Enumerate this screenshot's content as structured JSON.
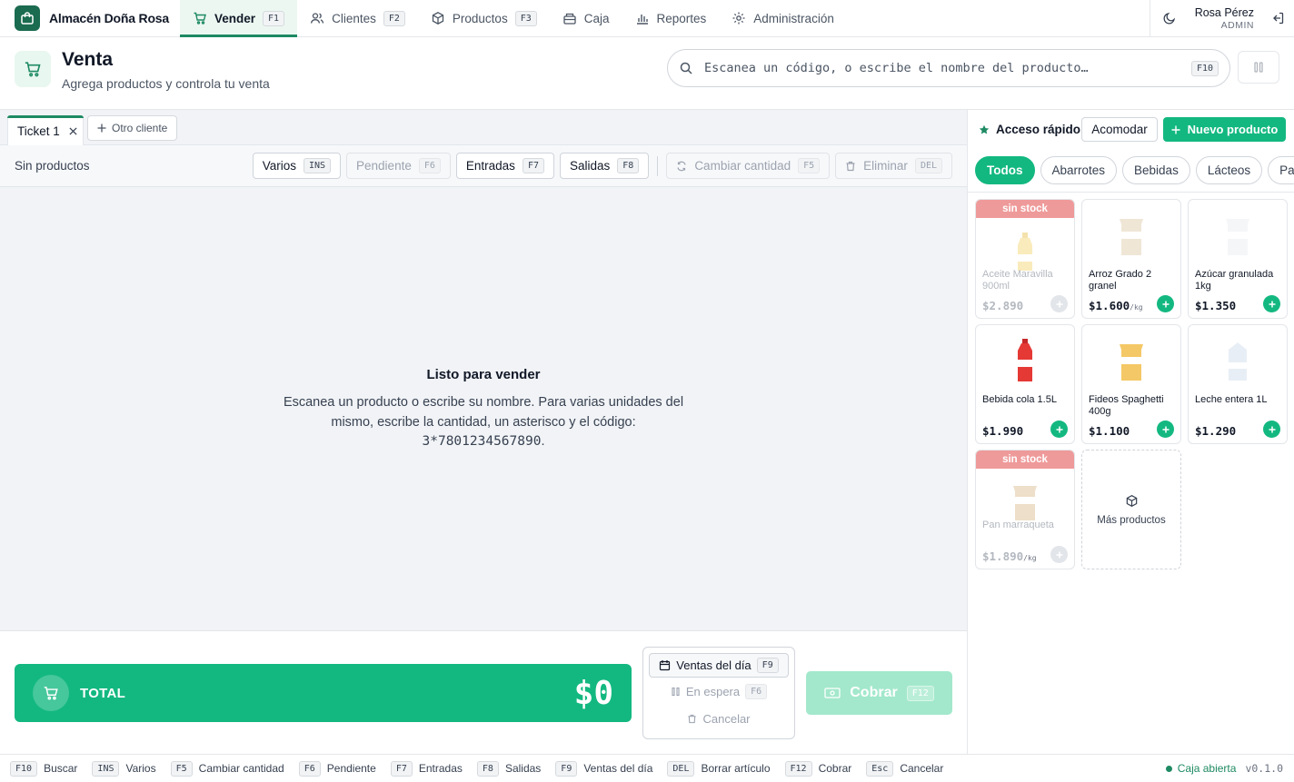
{
  "brand": {
    "name": "Almacén Doña Rosa",
    "icon": "bag-icon"
  },
  "nav": [
    {
      "label": "Vender",
      "key": "F1",
      "icon": "cart-icon",
      "active": true
    },
    {
      "label": "Clientes",
      "key": "F2",
      "icon": "users-icon"
    },
    {
      "label": "Productos",
      "key": "F3",
      "icon": "box-icon"
    },
    {
      "label": "Caja",
      "icon": "register-icon"
    },
    {
      "label": "Reportes",
      "icon": "chart-icon"
    },
    {
      "label": "Administración",
      "icon": "gear-icon"
    }
  ],
  "user": {
    "name": "Rosa Pérez",
    "role": "ADMIN"
  },
  "header": {
    "title": "Venta",
    "subtitle": "Agrega productos y controla tu venta",
    "search_placeholder": "Escanea un código, o escribe el nombre del producto…",
    "search_key": "F10"
  },
  "tabs": {
    "ticket": "Ticket 1",
    "new": "Otro cliente"
  },
  "toolbar": {
    "status": "Sin productos",
    "buttons": [
      {
        "label": "Varios",
        "key": "INS",
        "enabled": true
      },
      {
        "label": "Pendiente",
        "key": "F6",
        "enabled": false
      },
      {
        "label": "Entradas",
        "key": "F7",
        "enabled": true
      },
      {
        "label": "Salidas",
        "key": "F8",
        "enabled": true
      }
    ],
    "cambiar": {
      "label": "Cambiar cantidad",
      "key": "F5"
    },
    "eliminar": {
      "label": "Eliminar",
      "key": "DEL"
    }
  },
  "empty": {
    "title": "Listo para vender",
    "text": "Escanea un producto o escribe su nombre. Para varias unidades del mismo, escribe la cantidad, un asterisco y el código:",
    "code": "3*7801234567890",
    "period": "."
  },
  "total": {
    "label": "TOTAL",
    "amount": "$0"
  },
  "actions": {
    "ventas": {
      "label": "Ventas del día",
      "key": "F9"
    },
    "espera": {
      "label": "En espera",
      "key": "F6"
    },
    "cancelar": "Cancelar"
  },
  "cobrar": {
    "label": "Cobrar",
    "key": "F12"
  },
  "quick": {
    "title": "Acceso rápido",
    "acomodar": "Acomodar",
    "nuevo": "Nuevo producto",
    "categories": [
      "Todos",
      "Abarrotes",
      "Bebidas",
      "Lácteos",
      "Pan"
    ],
    "products": [
      {
        "name": "Aceite Maravilla 900ml",
        "price": "$2.890",
        "unit": "",
        "out_of_stock": true,
        "badge": "sin stock",
        "icon": "oil-bottle-icon"
      },
      {
        "name": "Arroz Grado 2 granel",
        "price": "$1.600",
        "unit": "/kg",
        "out_of_stock": false,
        "icon": "rice-bag-icon"
      },
      {
        "name": "Azúcar granulada 1kg",
        "price": "$1.350",
        "unit": "",
        "out_of_stock": false,
        "icon": "sugar-bag-icon"
      },
      {
        "name": "Bebida cola 1.5L",
        "price": "$1.990",
        "unit": "",
        "out_of_stock": false,
        "icon": "soda-bottle-icon"
      },
      {
        "name": "Fideos Spaghetti 400g",
        "price": "$1.100",
        "unit": "",
        "out_of_stock": false,
        "icon": "pasta-bag-icon"
      },
      {
        "name": "Leche entera 1L",
        "price": "$1.290",
        "unit": "",
        "out_of_stock": false,
        "icon": "milk-carton-icon"
      },
      {
        "name": "Pan marraqueta",
        "price": "$1.890",
        "unit": "/kg",
        "out_of_stock": true,
        "badge": "sin stock",
        "icon": "bread-bag-icon"
      }
    ],
    "more": "Más productos"
  },
  "statusbar": {
    "shortcuts": [
      {
        "key": "F10",
        "label": "Buscar"
      },
      {
        "key": "INS",
        "label": "Varios"
      },
      {
        "key": "F5",
        "label": "Cambiar cantidad"
      },
      {
        "key": "F6",
        "label": "Pendiente"
      },
      {
        "key": "F7",
        "label": "Entradas"
      },
      {
        "key": "F8",
        "label": "Salidas"
      },
      {
        "key": "F9",
        "label": "Ventas del día"
      },
      {
        "key": "DEL",
        "label": "Borrar artículo"
      },
      {
        "key": "F12",
        "label": "Cobrar"
      },
      {
        "key": "Esc",
        "label": "Cancelar"
      }
    ],
    "caja": "Caja abierta",
    "version": "v0.1.0"
  },
  "colors": {
    "accent": "#13b880",
    "brand": "#1a6b50",
    "active_border": "#1e8a63",
    "out_of_stock": "#ef9a9a"
  }
}
